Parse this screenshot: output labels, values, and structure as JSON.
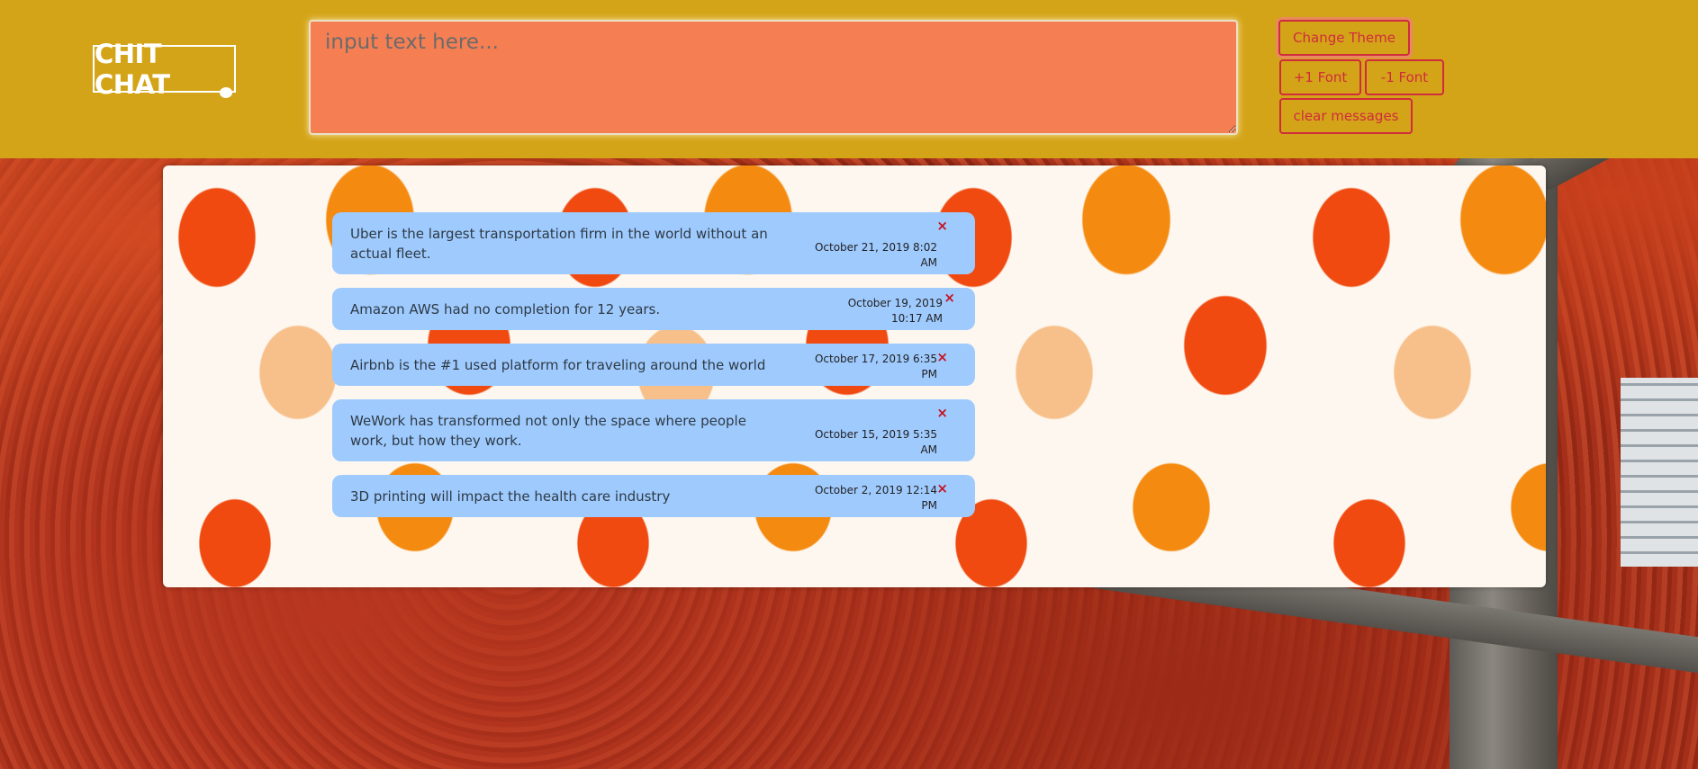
{
  "header": {
    "logo_text": "CHIT CHAT",
    "input_placeholder": "input text here...",
    "buttons": {
      "change_theme": "Change Theme",
      "font_plus": "+1 Font",
      "font_minus": "-1 Font",
      "clear": "clear messages"
    }
  },
  "messages": [
    {
      "text": "Uber is the largest transportation firm in the world without an actual fleet.",
      "time": "October 21, 2019 8:02 AM",
      "close": "×"
    },
    {
      "text": "Amazon AWS had no completion for 12 years.",
      "time": "October 19, 2019 10:17 AM",
      "close": "×"
    },
    {
      "text": "Airbnb is the #1 used platform for traveling around the world",
      "time": "October 17, 2019 6:35 PM",
      "close": "×"
    },
    {
      "text": "WeWork has transformed not only the space where people work, but how they work.",
      "time": "October 15, 2019 5:35 AM",
      "close": "×"
    },
    {
      "text": "3D printing will impact the health care industry",
      "time": "October 2, 2019 12:14 PM",
      "close": "×"
    }
  ],
  "colors": {
    "header_bg": "#d4a418",
    "input_bg": "#f57f53",
    "button_accent": "#cf2c3c",
    "message_bg": "#9fcafe",
    "close_icon": "#c4141f"
  }
}
